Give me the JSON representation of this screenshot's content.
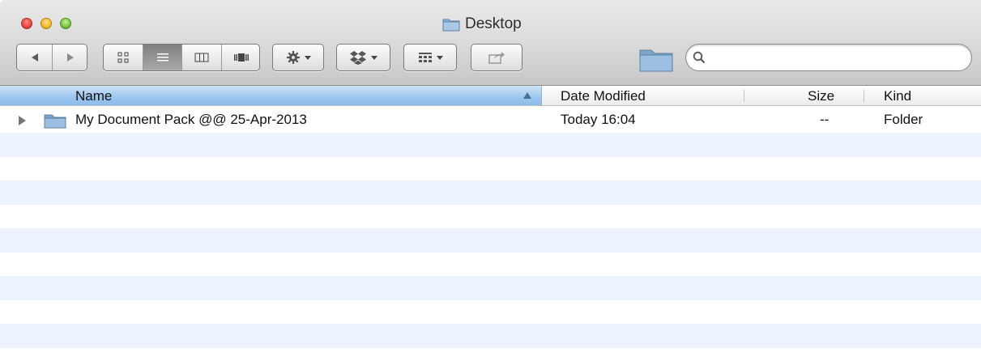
{
  "window": {
    "title": "Desktop",
    "icon": "folder-icon"
  },
  "toolbar": {
    "nav": {
      "back_icon": "back-arrow-icon",
      "forward_icon": "forward-arrow-icon"
    },
    "view_modes": [
      {
        "name": "icon-view",
        "icon": "grid-icon",
        "active": false
      },
      {
        "name": "list-view",
        "icon": "list-icon",
        "active": true
      },
      {
        "name": "column-view",
        "icon": "columns-icon",
        "active": false
      },
      {
        "name": "coverflow-view",
        "icon": "coverflow-icon",
        "active": false
      }
    ],
    "action_icon": "gear-icon",
    "dropbox_icon": "dropbox-icon",
    "arrange_icon": "arrange-grid-icon",
    "share_icon": "share-icon",
    "path_icon": "folder-icon"
  },
  "search": {
    "value": "",
    "placeholder": ""
  },
  "columns": [
    {
      "key": "name",
      "label": "Name",
      "sorted": true
    },
    {
      "key": "date",
      "label": "Date Modified"
    },
    {
      "key": "size",
      "label": "Size"
    },
    {
      "key": "kind",
      "label": "Kind"
    }
  ],
  "files": [
    {
      "name": "My Document Pack @@ 25-Apr-2013",
      "date": "Today 16:04",
      "size": "--",
      "kind": "Folder",
      "icon": "folder-icon",
      "expandable": true
    }
  ],
  "colors": {
    "header_selected": "#9cc6ee",
    "stripe": "#edf3fe",
    "folder": "#8fb3d6"
  }
}
